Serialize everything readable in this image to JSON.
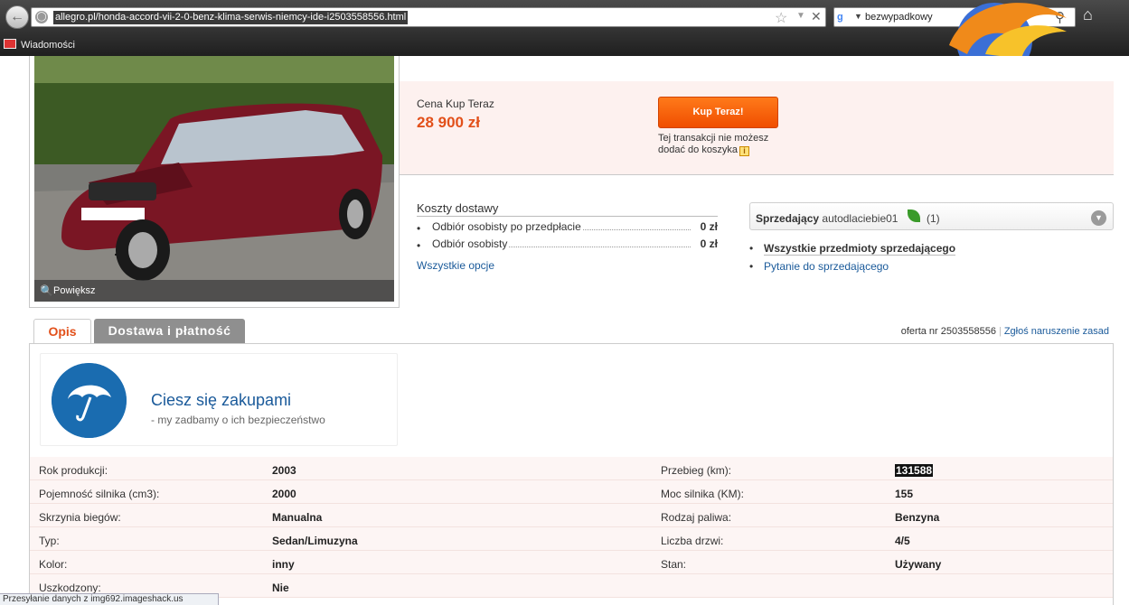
{
  "browser": {
    "url": "allegro.pl/honda-accord-vii-2-0-benz-klima-serwis-niemcy-ide-i2503558556.html",
    "search_query": "bezwypadkowy",
    "search_engine_icon": "google-icon",
    "bookmarks": [
      {
        "label": "Wiadomości"
      }
    ],
    "status_text": "Przesyłanie danych z img692.imageshack.us"
  },
  "photo": {
    "zoom_label": "Powiększ"
  },
  "price": {
    "label": "Cena Kup Teraz",
    "value": "28 900 zł",
    "buy_button": "Kup Teraz!",
    "cart_note": "Tej transakcji nie możesz dodać do koszyka",
    "accent_color": "#e2501a"
  },
  "delivery": {
    "title": "Koszty dostawy",
    "items": [
      {
        "name": "Odbiór osobisty po przedpłacie",
        "price": "0 zł"
      },
      {
        "name": "Odbiór osobisty",
        "price": "0 zł"
      }
    ],
    "all_options": "Wszystkie opcje"
  },
  "seller": {
    "label": "Sprzedający",
    "name": "autodlaciebie01",
    "rating": "(1)",
    "links": [
      {
        "label": "Wszystkie przedmioty sprzedającego"
      },
      {
        "label": "Pytanie do sprzedającego"
      }
    ]
  },
  "tabs": [
    {
      "label": "Opis",
      "active": true
    },
    {
      "label": "Dostawa i płatność",
      "active": false
    }
  ],
  "offer": {
    "number_text": "oferta nr 2503558556",
    "report_link": "Zgłoś naruszenie zasad"
  },
  "promo": {
    "title": "Ciesz się zakupami",
    "subtitle": "-   my zadbamy o ich bezpieczeństwo"
  },
  "params": [
    {
      "l1": "Rok produkcji:",
      "v1": "2003",
      "l2": "Przebieg (km):",
      "v2": "131588"
    },
    {
      "l1": "Pojemność silnika (cm3):",
      "v1": "2000",
      "l2": "Moc silnika (KM):",
      "v2": "155"
    },
    {
      "l1": "Skrzynia biegów:",
      "v1": "Manualna",
      "l2": "Rodzaj paliwa:",
      "v2": "Benzyna"
    },
    {
      "l1": "Typ:",
      "v1": "Sedan/Limuzyna",
      "l2": "Liczba drzwi:",
      "v2": "4/5"
    },
    {
      "l1": "Kolor:",
      "v1": "inny",
      "l2": "Stan:",
      "v2": "Używany"
    },
    {
      "l1": "Uszkodzony:",
      "v1": "Nie",
      "l2": "",
      "v2": ""
    }
  ]
}
